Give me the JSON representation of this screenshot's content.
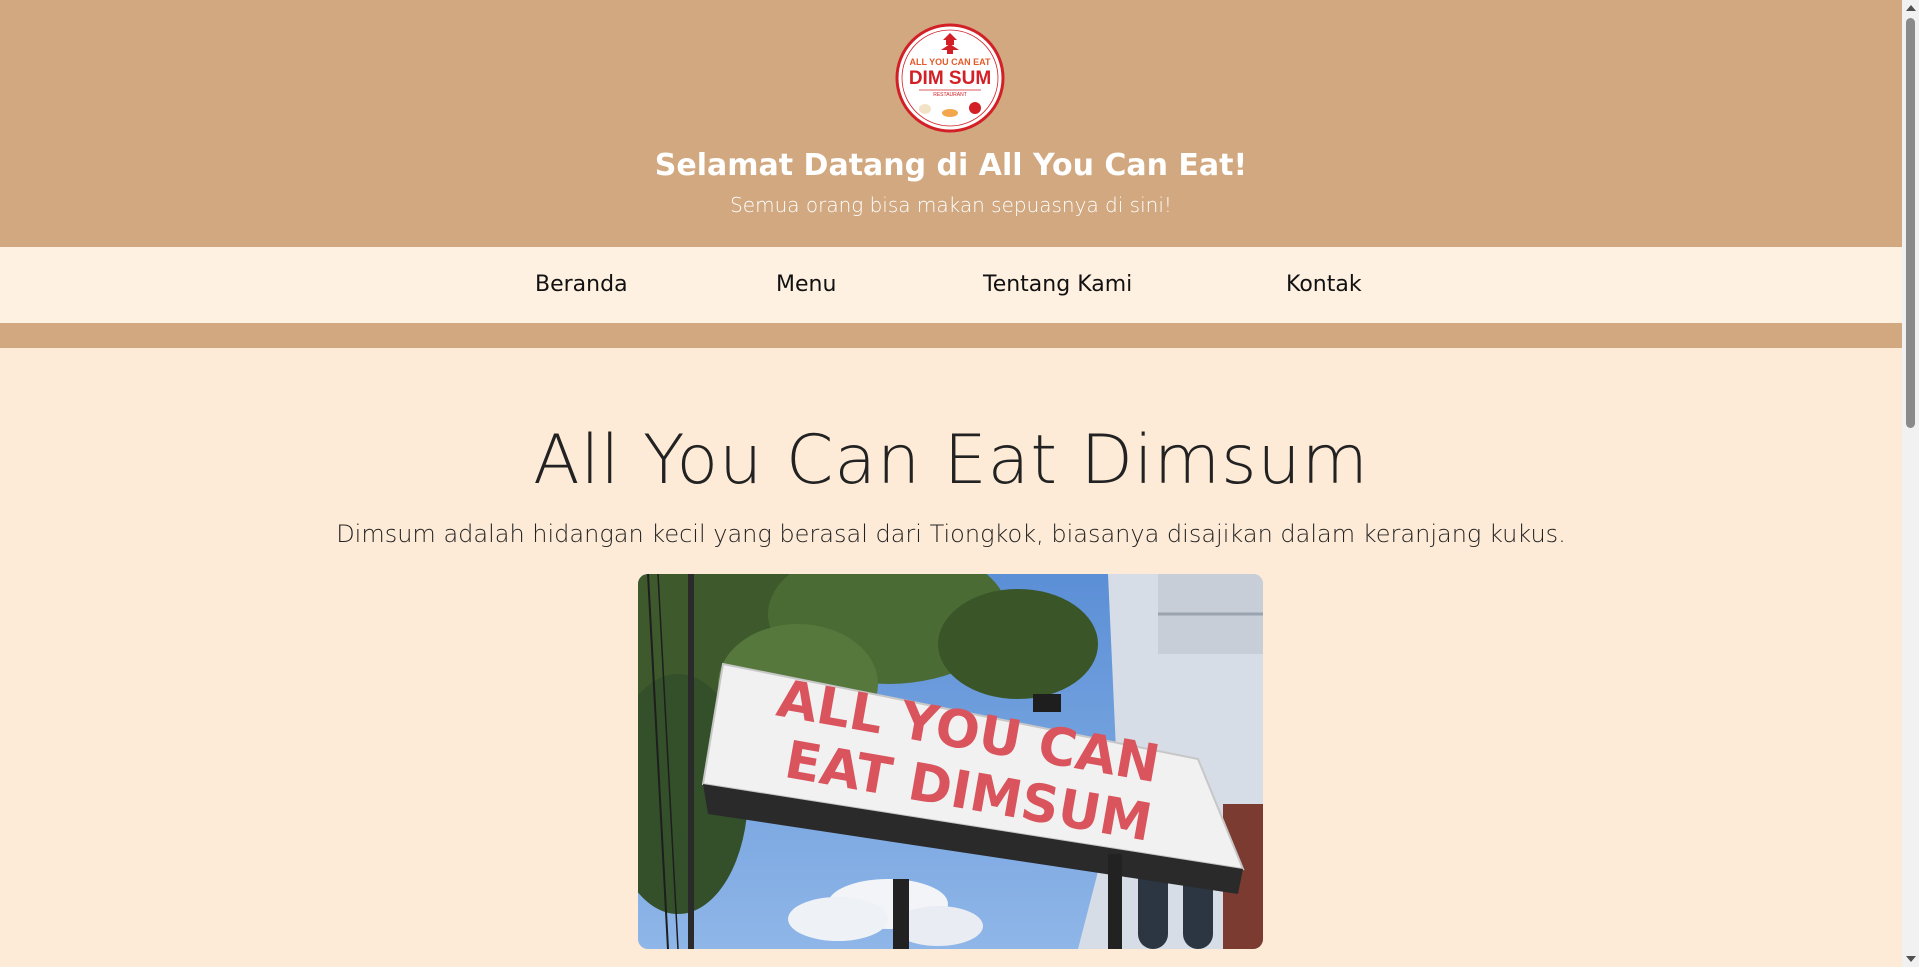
{
  "header": {
    "logo": {
      "top_text": "ALL YOU CAN EAT",
      "main_text": "DIM SUM",
      "bottom_text": "RESTAURANT"
    },
    "title": "Selamat Datang di All You Can Eat!",
    "subtitle": "Semua orang bisa makan sepuasnya di sini!"
  },
  "nav": {
    "items": [
      {
        "label": "Beranda"
      },
      {
        "label": "Menu"
      },
      {
        "label": "Tentang Kami"
      },
      {
        "label": "Kontak"
      }
    ]
  },
  "main": {
    "title": "All You Can Eat Dimsum",
    "description": "Dimsum adalah hidangan kecil yang berasal dari Tiongkok, biasanya disajikan dalam keranjang kukus.",
    "photo": {
      "sign_line1": "ALL YOU CAN",
      "sign_line2": "EAT DIMSUM"
    }
  },
  "colors": {
    "header_bg": "#d1a880",
    "nav_bg": "#fff1e1",
    "page_bg": "#fdebd7",
    "logo_red": "#d32027"
  }
}
